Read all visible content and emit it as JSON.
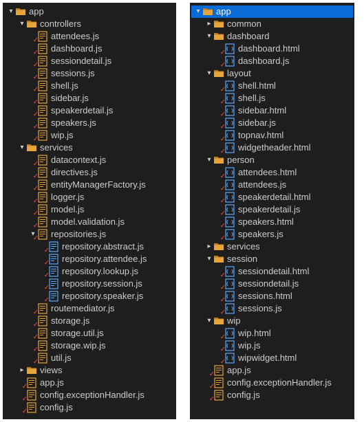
{
  "panelA": [
    {
      "d": 0,
      "c": "open",
      "i": "folder",
      "t": "app"
    },
    {
      "d": 1,
      "c": "open",
      "i": "folder",
      "t": "controllers"
    },
    {
      "d": 2,
      "c": "",
      "i": "js",
      "t": "attendees.js",
      "tick": true
    },
    {
      "d": 2,
      "c": "",
      "i": "js",
      "t": "dashboard.js",
      "tick": true
    },
    {
      "d": 2,
      "c": "",
      "i": "js",
      "t": "sessiondetail.js",
      "tick": true
    },
    {
      "d": 2,
      "c": "",
      "i": "js",
      "t": "sessions.js",
      "tick": true
    },
    {
      "d": 2,
      "c": "",
      "i": "js",
      "t": "shell.js",
      "tick": true
    },
    {
      "d": 2,
      "c": "",
      "i": "js",
      "t": "sidebar.js",
      "tick": true
    },
    {
      "d": 2,
      "c": "",
      "i": "js",
      "t": "speakerdetail.js",
      "tick": true
    },
    {
      "d": 2,
      "c": "",
      "i": "js",
      "t": "speakers.js",
      "tick": true
    },
    {
      "d": 2,
      "c": "",
      "i": "js",
      "t": "wip.js",
      "tick": true
    },
    {
      "d": 1,
      "c": "open",
      "i": "folder",
      "t": "services"
    },
    {
      "d": 2,
      "c": "",
      "i": "js",
      "t": "datacontext.js",
      "tick": true
    },
    {
      "d": 2,
      "c": "",
      "i": "js",
      "t": "directives.js",
      "tick": true
    },
    {
      "d": 2,
      "c": "",
      "i": "js",
      "t": "entityManagerFactory.js",
      "tick": true
    },
    {
      "d": 2,
      "c": "",
      "i": "js",
      "t": "logger.js",
      "tick": true
    },
    {
      "d": 2,
      "c": "",
      "i": "js",
      "t": "model.js",
      "tick": true
    },
    {
      "d": 2,
      "c": "",
      "i": "js",
      "t": "model.validation.js",
      "tick": true
    },
    {
      "d": 2,
      "c": "open",
      "i": "js",
      "t": "repositories.js",
      "tick": true
    },
    {
      "d": 3,
      "c": "",
      "i": "jsalt",
      "t": "repository.abstract.js",
      "tick": true
    },
    {
      "d": 3,
      "c": "",
      "i": "jsalt",
      "t": "repository.attendee.js",
      "tick": true
    },
    {
      "d": 3,
      "c": "",
      "i": "jsalt",
      "t": "repository.lookup.js",
      "tick": true
    },
    {
      "d": 3,
      "c": "",
      "i": "jsalt",
      "t": "repository.session.js",
      "tick": true
    },
    {
      "d": 3,
      "c": "",
      "i": "jsalt",
      "t": "repository.speaker.js",
      "tick": true
    },
    {
      "d": 2,
      "c": "",
      "i": "js",
      "t": "routemediator.js",
      "tick": true
    },
    {
      "d": 2,
      "c": "",
      "i": "js",
      "t": "storage.js",
      "tick": true
    },
    {
      "d": 2,
      "c": "",
      "i": "js",
      "t": "storage.util.js",
      "tick": true
    },
    {
      "d": 2,
      "c": "",
      "i": "js",
      "t": "storage.wip.js",
      "tick": true
    },
    {
      "d": 2,
      "c": "",
      "i": "js",
      "t": "util.js",
      "tick": true
    },
    {
      "d": 1,
      "c": "closed",
      "i": "folder",
      "t": "views"
    },
    {
      "d": 1,
      "c": "",
      "i": "js",
      "t": "app.js",
      "tick": true
    },
    {
      "d": 1,
      "c": "",
      "i": "js",
      "t": "config.exceptionHandler.js",
      "tick": true
    },
    {
      "d": 1,
      "c": "",
      "i": "js",
      "t": "config.js",
      "tick": true
    }
  ],
  "panelB": [
    {
      "d": 0,
      "c": "open",
      "i": "folder",
      "t": "app",
      "sel": true
    },
    {
      "d": 1,
      "c": "closed",
      "i": "folder",
      "t": "common"
    },
    {
      "d": 1,
      "c": "open",
      "i": "folder",
      "t": "dashboard"
    },
    {
      "d": 2,
      "c": "",
      "i": "html",
      "t": "dashboard.html",
      "tick": true
    },
    {
      "d": 2,
      "c": "",
      "i": "html",
      "t": "dashboard.js",
      "tick": true
    },
    {
      "d": 1,
      "c": "open",
      "i": "folder",
      "t": "layout"
    },
    {
      "d": 2,
      "c": "",
      "i": "html",
      "t": "shell.html",
      "tick": true
    },
    {
      "d": 2,
      "c": "",
      "i": "html",
      "t": "shell.js",
      "tick": true
    },
    {
      "d": 2,
      "c": "",
      "i": "html",
      "t": "sidebar.html",
      "tick": true
    },
    {
      "d": 2,
      "c": "",
      "i": "html",
      "t": "sidebar.js",
      "tick": true
    },
    {
      "d": 2,
      "c": "",
      "i": "html",
      "t": "topnav.html",
      "tick": true
    },
    {
      "d": 2,
      "c": "",
      "i": "html",
      "t": "widgetheader.html",
      "tick": true
    },
    {
      "d": 1,
      "c": "open",
      "i": "folder",
      "t": "person"
    },
    {
      "d": 2,
      "c": "",
      "i": "html",
      "t": "attendees.html",
      "tick": true
    },
    {
      "d": 2,
      "c": "",
      "i": "html",
      "t": "attendees.js",
      "tick": true
    },
    {
      "d": 2,
      "c": "",
      "i": "html",
      "t": "speakerdetail.html",
      "tick": true
    },
    {
      "d": 2,
      "c": "",
      "i": "html",
      "t": "speakerdetail.js",
      "tick": true
    },
    {
      "d": 2,
      "c": "",
      "i": "html",
      "t": "speakers.html",
      "tick": true
    },
    {
      "d": 2,
      "c": "",
      "i": "html",
      "t": "speakers.js",
      "tick": true
    },
    {
      "d": 1,
      "c": "closed",
      "i": "folder",
      "t": "services"
    },
    {
      "d": 1,
      "c": "open",
      "i": "folder",
      "t": "session"
    },
    {
      "d": 2,
      "c": "",
      "i": "html",
      "t": "sessiondetail.html",
      "tick": true
    },
    {
      "d": 2,
      "c": "",
      "i": "html",
      "t": "sessiondetail.js",
      "tick": true
    },
    {
      "d": 2,
      "c": "",
      "i": "html",
      "t": "sessions.html",
      "tick": true
    },
    {
      "d": 2,
      "c": "",
      "i": "html",
      "t": "sessions.js",
      "tick": true
    },
    {
      "d": 1,
      "c": "open",
      "i": "folder",
      "t": "wip"
    },
    {
      "d": 2,
      "c": "",
      "i": "html",
      "t": "wip.html",
      "tick": true
    },
    {
      "d": 2,
      "c": "",
      "i": "html",
      "t": "wip.js",
      "tick": true
    },
    {
      "d": 2,
      "c": "",
      "i": "html",
      "t": "wipwidget.html",
      "tick": true
    },
    {
      "d": 1,
      "c": "",
      "i": "js",
      "t": "app.js",
      "tick": true
    },
    {
      "d": 1,
      "c": "",
      "i": "js",
      "t": "config.exceptionHandler.js",
      "tick": true
    },
    {
      "d": 1,
      "c": "",
      "i": "js",
      "t": "config.js",
      "tick": true
    }
  ]
}
